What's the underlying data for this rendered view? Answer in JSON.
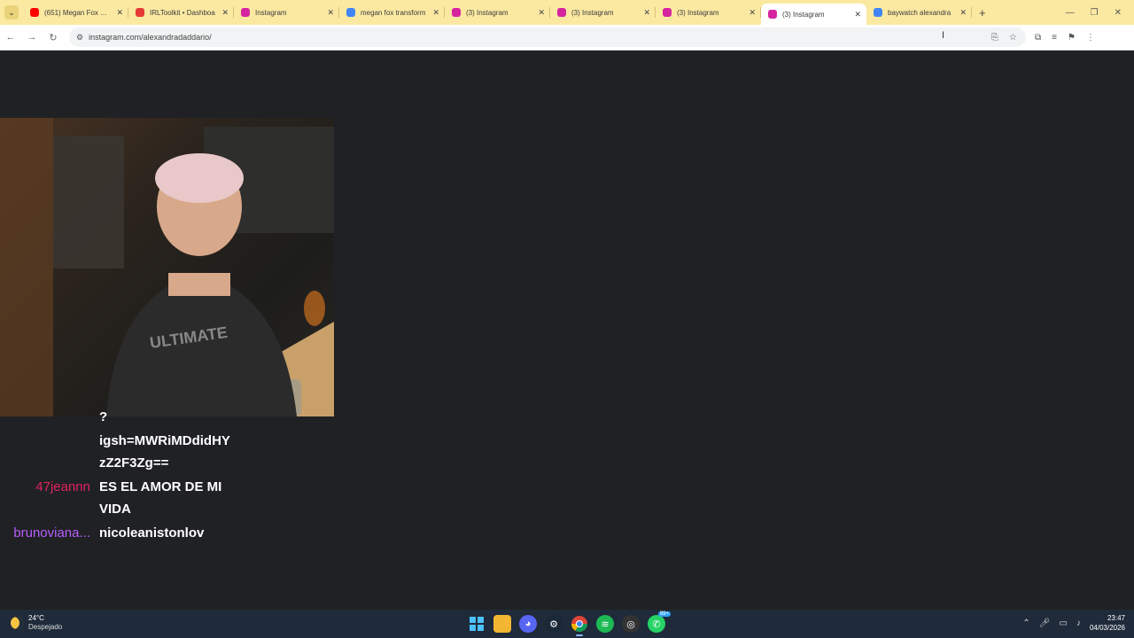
{
  "browser": {
    "tabs": [
      {
        "title": "(651) Megan Fox Tran",
        "favicon_color": "#ff0000",
        "active": false
      },
      {
        "title": "IRLToolkit • Dashboa",
        "favicon_color": "#e53935",
        "active": false
      },
      {
        "title": "Instagram",
        "favicon_color": "#d6249f",
        "active": false
      },
      {
        "title": "megan fox transform",
        "favicon_color": "#4285f4",
        "active": false
      },
      {
        "title": "(3) Instagram",
        "favicon_color": "#d6249f",
        "active": false
      },
      {
        "title": "(3) Instagram",
        "favicon_color": "#d6249f",
        "active": false
      },
      {
        "title": "(3) Instagram",
        "favicon_color": "#d6249f",
        "active": false
      },
      {
        "title": "(3) Instagram",
        "favicon_color": "#d6249f",
        "active": true
      },
      {
        "title": "baywatch alexandra",
        "favicon_color": "#4285f4",
        "active": false
      }
    ],
    "url": "instagram.com/alexandradaddario/",
    "tabstrip_color": "#fbe9a2"
  },
  "chat": {
    "lines": [
      {
        "user": "",
        "message": "?",
        "user_color": "#ffffff"
      },
      {
        "user": "",
        "message": "igsh=MWRiMDdidHY",
        "user_color": "#ffffff"
      },
      {
        "user": "",
        "message": "zZ2F3Zg==",
        "user_color": "#ffffff"
      },
      {
        "user": "47jeannn",
        "message": "ES EL AMOR DE MI",
        "user_color": "#e0245e"
      },
      {
        "user": "",
        "message": "VIDA",
        "user_color": "#ffffff"
      },
      {
        "user": "brunoviana...",
        "message": "nicoleanistonlov",
        "user_color": "#b65cff"
      }
    ]
  },
  "taskbar": {
    "weather_temp": "24°C",
    "weather_desc": "Despejado",
    "time": "23:47",
    "date": "04/03/2026",
    "apps": [
      "windows-start",
      "file-explorer",
      "discord",
      "steam",
      "chrome",
      "spotify",
      "obs",
      "whatsapp"
    ],
    "whatsapp_badge": "99+"
  }
}
